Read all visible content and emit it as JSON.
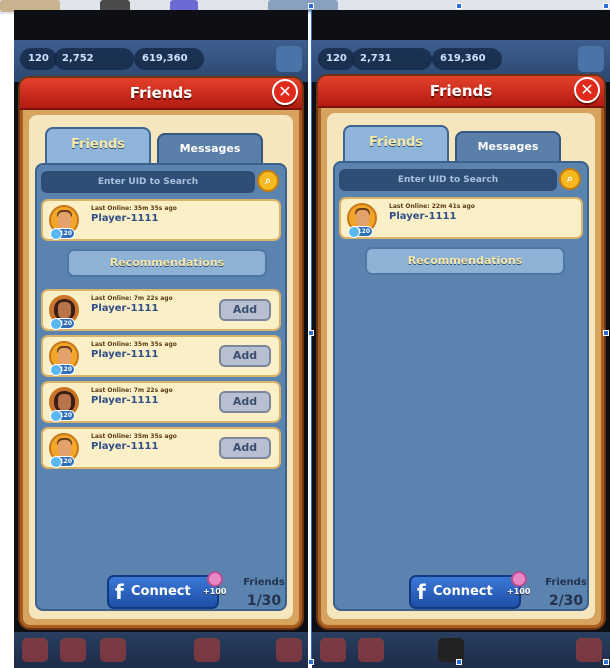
{
  "screens": [
    {
      "hud": {
        "level": "120",
        "gems": "2,752",
        "coins": "619,360"
      },
      "dialog_title": "Friends",
      "close_label": "✕",
      "tabs": {
        "friends": "Friends",
        "messages": "Messages"
      },
      "search_placeholder": "Enter UID to Search",
      "friends": [
        {
          "last_online": "Last Online: 35m 35s ago",
          "name": "Player-1111",
          "level": "120",
          "avatar": "man"
        }
      ],
      "recommendations_label": "Recommendations",
      "recommendations": [
        {
          "last_online": "Last Online: 7m 22s ago",
          "name": "Player-1111",
          "level": "120",
          "avatar": "woman",
          "action": "Add"
        },
        {
          "last_online": "Last Online: 35m 35s ago",
          "name": "Player-1111",
          "level": "120",
          "avatar": "man",
          "action": "Add"
        },
        {
          "last_online": "Last Online: 7m 22s ago",
          "name": "Player-1111",
          "level": "120",
          "avatar": "woman",
          "action": "Add"
        },
        {
          "last_online": "Last Online: 35m 35s ago",
          "name": "Player-1111",
          "level": "120",
          "avatar": "man",
          "action": "Add"
        }
      ],
      "connect_label": "Connect",
      "connect_bonus": "+100",
      "friends_label": "Friends",
      "friends_count": "1/30"
    },
    {
      "hud": {
        "level": "120",
        "gems": "2,731",
        "coins": "619,360"
      },
      "dialog_title": "Friends",
      "close_label": "✕",
      "tabs": {
        "friends": "Friends",
        "messages": "Messages"
      },
      "search_placeholder": "Enter UID to Search",
      "friends": [
        {
          "last_online": "Last Online: 22m 41s ago",
          "name": "Player-1111",
          "level": "120",
          "avatar": "man"
        }
      ],
      "recommendations_label": "Recommendations",
      "recommendations": [],
      "connect_label": "Connect",
      "connect_bonus": "+100",
      "friends_label": "Friends",
      "friends_count": "2/30"
    }
  ],
  "colors": {
    "dialog_header": "#d82c1e",
    "panel": "#5b83b0",
    "card": "#fbefc7",
    "connect": "#2b62c2",
    "add_button": "#b7bfd0",
    "selection": "#2d6cd3"
  },
  "icons": [
    "close-icon",
    "search-icon",
    "facebook-icon",
    "potion-icon",
    "level-star-icon"
  ]
}
